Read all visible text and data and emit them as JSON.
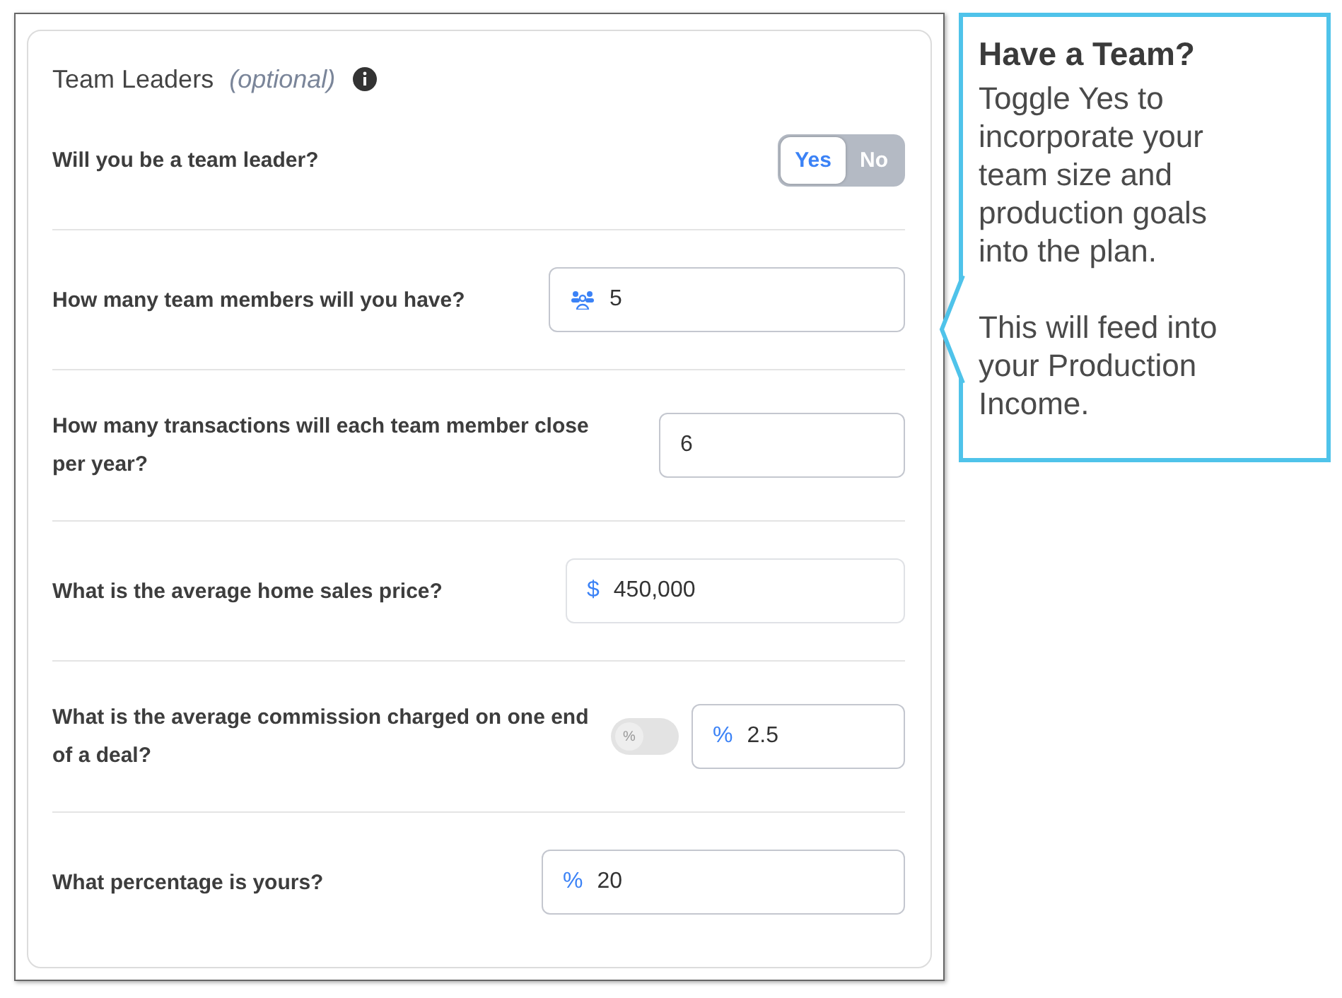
{
  "section": {
    "title": "Team Leaders",
    "note": "(optional)"
  },
  "leader_question": {
    "question": "Will you be a team leader?",
    "options": [
      {
        "label": "Yes",
        "selected": true
      },
      {
        "label": "No",
        "selected": false
      }
    ]
  },
  "fields": [
    {
      "question": "How many team members will you have?",
      "kind": "icon",
      "value": "5"
    },
    {
      "question": "How many transactions will each team member close per year?",
      "kind": "plain",
      "value": "6"
    },
    {
      "question": "What is the average home sales price?",
      "kind": "prefix",
      "prefix": "$",
      "value": "450,000"
    },
    {
      "question": "What is the average commission charged on one end of a deal?",
      "kind": "prefix",
      "prefix": "%",
      "value": "2.5",
      "unit_toggle": {
        "label": "%",
        "on": false
      }
    },
    {
      "question": "What percentage is yours?",
      "kind": "prefix",
      "prefix": "%",
      "value": "20"
    }
  ],
  "callout": {
    "title": "Have a Team?",
    "paragraphs": [
      "Toggle Yes to incorporate your team size and production goals into the plan.",
      "This will feed into your Production Income."
    ]
  }
}
